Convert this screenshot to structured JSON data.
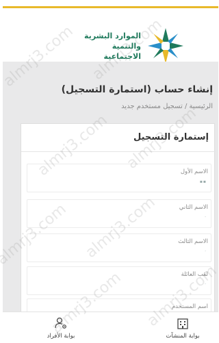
{
  "brand": {
    "line1": "الموارد البشرية",
    "line2": "والتنمية الاجتماعية",
    "logo_icon": "ministry-star-logo-icon",
    "colors": {
      "green": "#1f7a5c",
      "yellow": "#e8b92a",
      "blue": "#2a8fc9"
    }
  },
  "page": {
    "title": "إنشاء حساب (استمارة التسجيل)",
    "breadcrumb": "الرئيسية / تسجيل مستخدم جديد"
  },
  "form": {
    "title": "إستمارة التسجيل",
    "fields": [
      {
        "label": "الاسم الأول",
        "value": "▪▪"
      },
      {
        "label": "الاسم الثاني",
        "value": "·"
      },
      {
        "label": "الاسم الثالث",
        "value": "·"
      },
      {
        "label": "لقب العائلة",
        "value": "·"
      },
      {
        "label": "اسم المستخدم",
        "value": "▪▪▪▪"
      }
    ]
  },
  "bottom_nav": {
    "individuals": {
      "label": "بوابة الأفراد",
      "icon": "user-gear-icon"
    },
    "establishments": {
      "label": "بوابة المنشآت",
      "icon": "building-icon"
    }
  },
  "watermark": "almrj3.com"
}
